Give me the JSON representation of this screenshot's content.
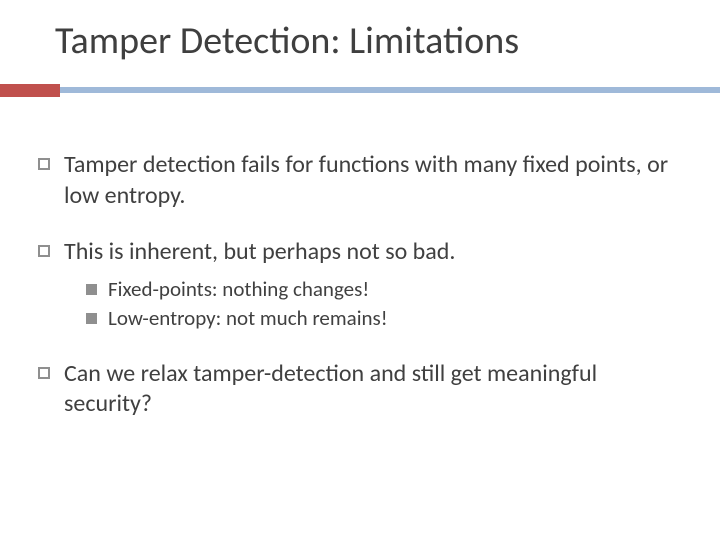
{
  "title": "Tamper Detection: Limitations",
  "bullets": {
    "b1": "Tamper detection fails for functions with many fixed points, or low entropy.",
    "b2": "This is inherent, but perhaps not so bad.",
    "b2_sub1": "Fixed-points:  nothing changes!",
    "b2_sub2": "Low-entropy:  not much remains!",
    "b3": "Can we relax tamper-detection and still get meaningful security?"
  }
}
